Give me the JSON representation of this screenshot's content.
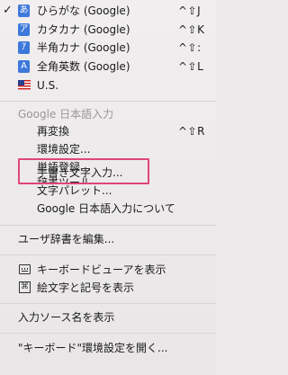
{
  "input_modes": [
    {
      "icon_char": "あ",
      "label": "ひらがな (Google)",
      "shortcut": "^⇧J",
      "checked": true
    },
    {
      "icon_char": "ア",
      "label": "カタカナ (Google)",
      "shortcut": "^⇧K",
      "checked": false
    },
    {
      "icon_char": "ｱ",
      "label": "半角カナ (Google)",
      "shortcut": "^⇧:",
      "checked": false
    },
    {
      "icon_char": "A",
      "label": "全角英数 (Google)",
      "shortcut": "^⇧L",
      "checked": false
    }
  ],
  "us_layout": {
    "label": "U.S.",
    "icon": "us-flag-icon"
  },
  "check_mark": "✓",
  "google_section": {
    "header": "Google 日本語入力",
    "items": [
      {
        "label": "再変換",
        "shortcut": "^⇧R"
      },
      {
        "label": "環境設定...",
        "shortcut": ""
      },
      {
        "label": "単語登録...",
        "shortcut": ""
      },
      {
        "label": "辞書ツール...",
        "shortcut": ""
      },
      {
        "label": "手書き文字入力...",
        "shortcut": ""
      },
      {
        "label": "文字パレット...",
        "shortcut": ""
      },
      {
        "label": "Google 日本語入力について",
        "shortcut": ""
      }
    ]
  },
  "user_dict": {
    "label": "ユーザ辞書を編集..."
  },
  "viewer_items": [
    {
      "label": "キーボードビューアを表示",
      "icon": "keyboard-icon"
    },
    {
      "label": "絵文字と記号を表示",
      "icon": "emoji-symbols-icon",
      "icon_char": "⌘"
    }
  ],
  "show_input_source": {
    "label": "入力ソース名を表示"
  },
  "keyboard_prefs": {
    "label": "\"キーボード\"環境設定を開く..."
  },
  "colors": {
    "accent_icon": "#3d78db",
    "highlight_border": "#e0457c",
    "header_text": "#9a9697"
  }
}
